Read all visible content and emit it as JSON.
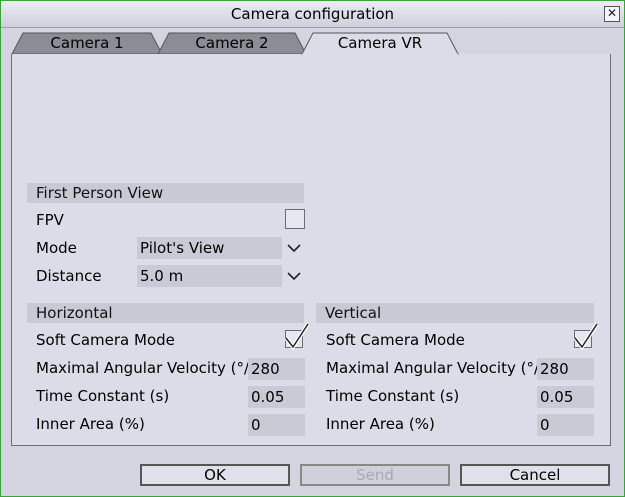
{
  "window": {
    "title": "Camera configuration",
    "close_glyph": "✕"
  },
  "tabs": [
    {
      "label": "Camera 1",
      "active": false
    },
    {
      "label": "Camera 2",
      "active": false
    },
    {
      "label": "Camera VR",
      "active": true
    }
  ],
  "fpv": {
    "header": "First Person View",
    "fpv_label": "FPV",
    "fpv_checked": false,
    "mode_label": "Mode",
    "mode_value": "Pilot's View",
    "distance_label": "Distance",
    "distance_value": "5.0 m"
  },
  "horizontal": {
    "header": "Horizontal",
    "soft_label": "Soft Camera Mode",
    "soft_checked": true,
    "velocity_label": "Maximal Angular Velocity (°/s)",
    "velocity_value": "280",
    "time_label": "Time Constant (s)",
    "time_value": "0.05",
    "inner_label": "Inner Area (%)",
    "inner_value": "0"
  },
  "vertical": {
    "header": "Vertical",
    "soft_label": "Soft Camera Mode",
    "soft_checked": true,
    "velocity_label": "Maximal Angular Velocity (°/s)",
    "velocity_value": "280",
    "time_label": "Time Constant (s)",
    "time_value": "0.05",
    "inner_label": "Inner Area (%)",
    "inner_value": "0"
  },
  "buttons": {
    "ok": "OK",
    "send": "Send",
    "cancel": "Cancel"
  },
  "colors": {
    "desktop": "#2e8b2e",
    "dialog": "#d4d4e0",
    "active_tab": "#e4e4ee",
    "inactive_tab": "#8c8c96"
  }
}
